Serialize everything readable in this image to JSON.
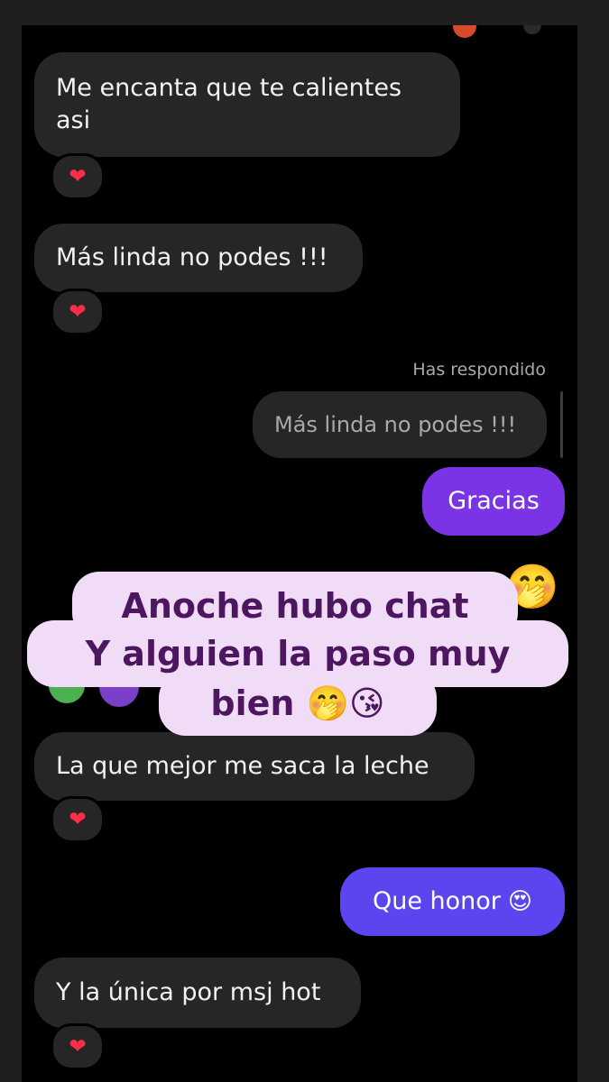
{
  "messages": {
    "m1": {
      "text": "Me encanta que te calientes asi",
      "reaction": "❤"
    },
    "m2": {
      "text": "Más linda no podes !!!",
      "reaction": "❤"
    },
    "reply": {
      "label": "Has respondido",
      "quoted": "Más linda no podes !!!"
    },
    "m3": {
      "text": "Gracias"
    },
    "m4": {
      "text": "La que mejor me saca la leche",
      "reaction": "❤"
    },
    "m5": {
      "text": "Que honor",
      "emoji": "😍"
    },
    "m6": {
      "text": "Y la única por msj hot",
      "reaction": "❤"
    }
  },
  "overlay": {
    "line1": "Anoche hubo chat",
    "line2": "Y alguien la paso muy",
    "line3": "bien 🤭😘",
    "peek_emoji": "🤭"
  },
  "colors": {
    "background": "#000000",
    "incoming_bubble": "#262626",
    "outgoing_purple": "#7b33e6",
    "outgoing_indigo": "#5b45ee",
    "heart": "#ff2d45",
    "overlay_bg": "#f1dcf8",
    "overlay_text": "#4d1760"
  },
  "icons": {
    "reaction": "heart-icon"
  }
}
